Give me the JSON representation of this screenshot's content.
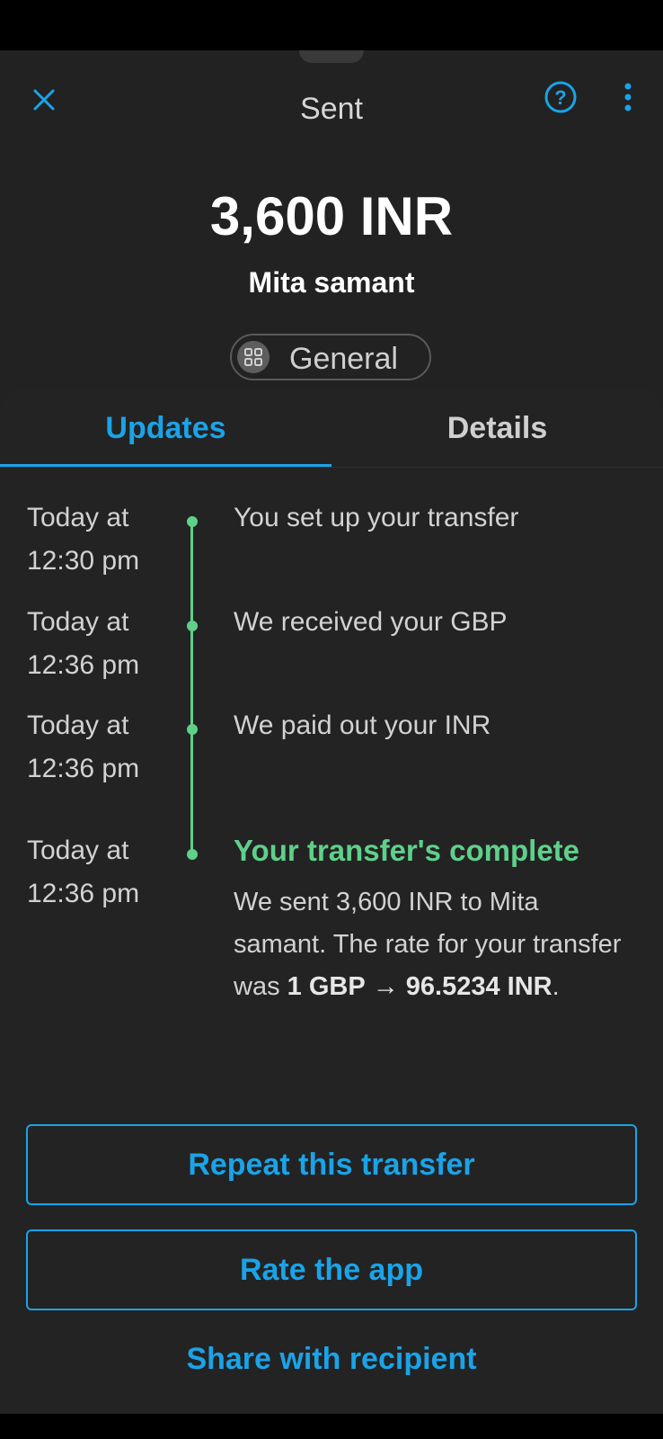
{
  "header": {
    "title": "Sent",
    "close_icon": "close-icon",
    "help_icon": "help-circle-icon",
    "more_icon": "more-vertical-icon"
  },
  "transfer": {
    "amount": "3,600 INR",
    "recipient": "Mita samant",
    "category": "General",
    "category_icon": "grid-icon"
  },
  "tabs": [
    {
      "label": "Updates",
      "active": true
    },
    {
      "label": "Details",
      "active": false
    }
  ],
  "timeline": [
    {
      "time_line1": "Today at",
      "time_line2": "12:30 pm",
      "title": "You set up your transfer"
    },
    {
      "time_line1": "Today at",
      "time_line2": "12:36 pm",
      "title": "We received your GBP"
    },
    {
      "time_line1": "Today at",
      "time_line2": "12:36 pm",
      "title": "We paid out your INR"
    },
    {
      "time_line1": "Today at",
      "time_line2": "12:36 pm",
      "title": "Your transfer's complete",
      "body_part1": "We sent 3,600 INR to Mita samant. The rate for your transfer was ",
      "body_rate_from": "1 GBP",
      "body_arrow": "→",
      "body_rate_to": "96.5234 INR",
      "body_end": "."
    }
  ],
  "buttons": {
    "repeat": "Repeat this transfer",
    "rate": "Rate the app",
    "share": "Share with recipient"
  },
  "colors": {
    "accent": "#1aa3e8",
    "success": "#5fd08a",
    "background": "#222222"
  }
}
